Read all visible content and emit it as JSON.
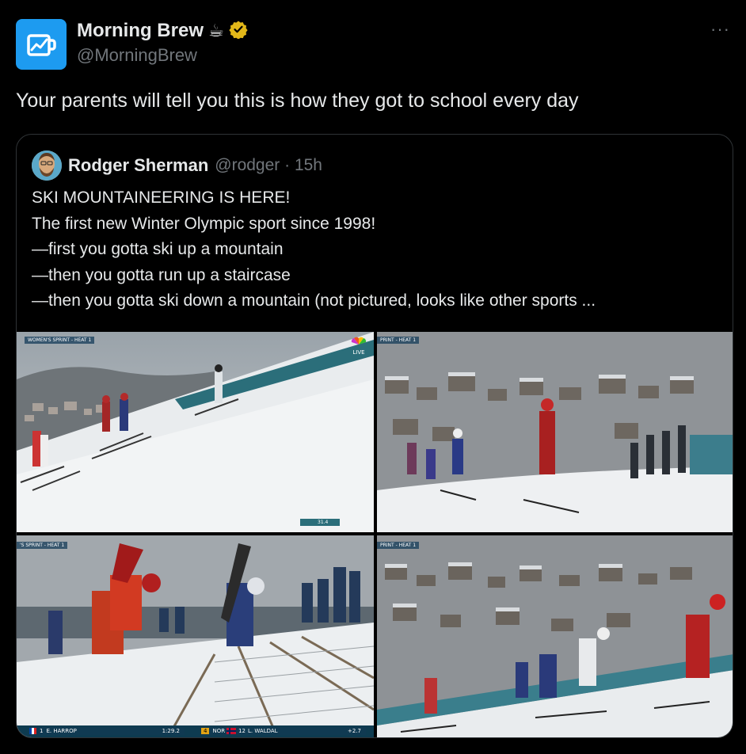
{
  "post": {
    "author_name": "Morning Brew",
    "author_emoji": "☕",
    "author_handle": "@MorningBrew",
    "more_label": "···",
    "text": "Your parents will tell you this is how they got to school every day",
    "verified_color": "#e2b719",
    "brand_color": "#1d9bf0"
  },
  "quote": {
    "author_name": "Rodger Sherman",
    "author_meta": "@rodger · 15h",
    "lines": [
      "SKI MOUNTAINEERING IS HERE!",
      "The first new Winter Olympic sport since 1998!",
      "—first you gotta ski up a mountain",
      "—then you gotta run up a staircase",
      "—then you gotta ski down a mountain (not pictured, looks like other sports ..."
    ]
  },
  "media": {
    "img1": {
      "label": "WOMEN'S SPRINT - HEAT 1",
      "network": "LIVE",
      "timer": "31.4"
    },
    "img2": {
      "label": "PRINT - HEAT 1"
    },
    "img3": {
      "label": "'S SPRINT - HEAT 1",
      "rank1": "1",
      "athlete1": "E. HARROP",
      "time1": "1:29.2",
      "rank2": "4",
      "country2": "NOR",
      "bib2": "12",
      "athlete2": "L. WALDAL",
      "gap2": "+2.7"
    },
    "img4": {
      "label": "PRINT - HEAT 1"
    }
  },
  "icons": {
    "avatar": "morning-brew-logo-icon",
    "verified": "verified-badge-icon",
    "more": "more-options-icon"
  }
}
